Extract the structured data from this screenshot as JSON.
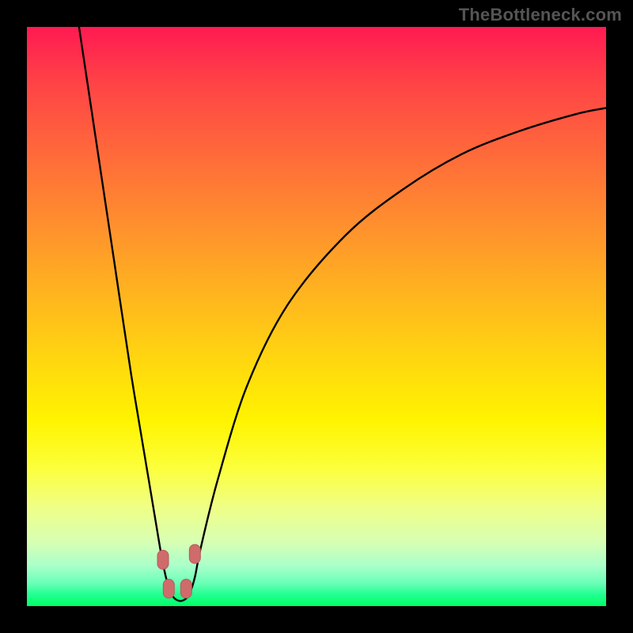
{
  "watermark": "TheBottleneck.com",
  "colors": {
    "frame": "#000000",
    "curve_stroke": "#000000",
    "marker_fill": "#cf6b6b",
    "marker_stroke": "#b85a5a"
  },
  "chart_data": {
    "type": "line",
    "title": "",
    "xlabel": "",
    "ylabel": "",
    "xlim": [
      0,
      100
    ],
    "ylim": [
      0,
      100
    ],
    "x": [
      9,
      12,
      15,
      18,
      21,
      23,
      24,
      25,
      26,
      27,
      28,
      29,
      30,
      33,
      38,
      45,
      55,
      65,
      75,
      85,
      95,
      100
    ],
    "values": [
      100,
      80,
      60,
      40,
      22,
      10,
      5,
      2,
      1,
      1,
      2,
      5,
      10,
      22,
      38,
      52,
      64,
      72,
      78,
      82,
      85,
      86
    ],
    "markers": [
      {
        "x": 23.5,
        "y": 8
      },
      {
        "x": 24.5,
        "y": 3
      },
      {
        "x": 27.5,
        "y": 3
      },
      {
        "x": 29.0,
        "y": 9
      }
    ],
    "grid": false,
    "legend": false,
    "annotations": []
  }
}
